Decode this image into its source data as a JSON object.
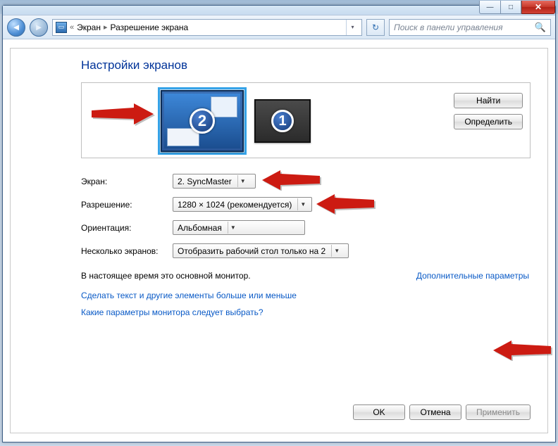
{
  "titlebar": {
    "min_glyph": "—",
    "max_glyph": "□",
    "close_glyph": "✕"
  },
  "nav": {
    "back_glyph": "◄",
    "fwd_glyph": "►",
    "breadcrumb_prefix": "«",
    "crumb1": "Экран",
    "crumb_sep": "▸",
    "crumb2": "Разрешение экрана",
    "dropdown_glyph": "▾",
    "refresh_glyph": "↻",
    "search_placeholder": "Поиск в панели управления",
    "search_glyph": "🔍"
  },
  "heading": "Настройки экранов",
  "monitors": {
    "mon2_label": "2",
    "mon1_label": "1",
    "find_btn": "Найти",
    "identify_btn": "Определить"
  },
  "form": {
    "screen_label": "Экран:",
    "screen_value": "2. SyncMaster",
    "res_label": "Разрешение:",
    "res_value": "1280 × 1024 (рекомендуется)",
    "orient_label": "Ориентация:",
    "orient_value": "Альбомная",
    "multi_label": "Несколько экранов:",
    "multi_value": "Отобразить рабочий стол только на 2",
    "combo_arrow": "▼"
  },
  "status": {
    "primary_text": "В настоящее время это основной монитор.",
    "advanced_link": "Дополнительные параметры"
  },
  "links": {
    "text_size": "Сделать текст и другие элементы больше или меньше",
    "which_settings": "Какие параметры монитора следует выбрать?"
  },
  "buttons": {
    "ok": "OK",
    "cancel": "Отмена",
    "apply": "Применить"
  }
}
